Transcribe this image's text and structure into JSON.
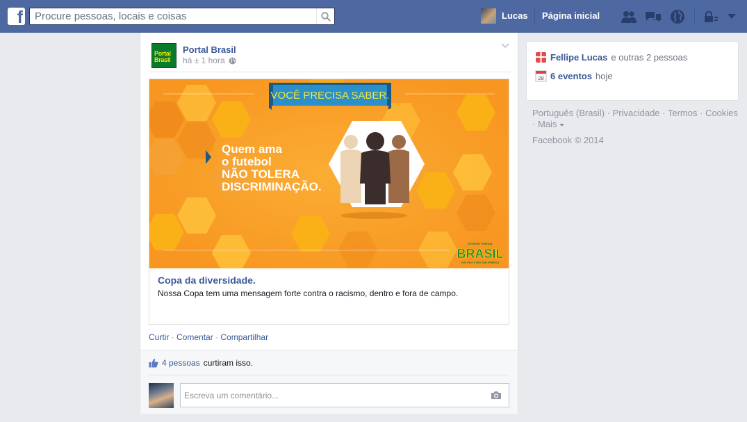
{
  "topbar": {
    "logo": "f",
    "search_placeholder": "Procure pessoas, locais e coisas",
    "user_name": "Lucas",
    "home_label": "Página inicial",
    "icons": [
      "friend-requests-icon",
      "messages-icon",
      "notifications-globe-icon",
      "privacy-lock-icon",
      "account-menu-chevron-icon"
    ]
  },
  "post": {
    "page_logo_line1": "Portal",
    "page_logo_line2": "Brasil",
    "author": "Portal Brasil",
    "time": "há ± 1 hora",
    "banner": {
      "tag": "VOCÊ PRECISA SABER.",
      "line1": "Quem ama",
      "line2": "o futebol",
      "line3": "NÃO TOLERA",
      "line4": "DISCRIMINAÇÃO.",
      "brand": "BRASIL",
      "brand_top": "GOVERNO FEDERAL",
      "brand_bottom": "PAÍS RICO É PAÍS SEM POBREZA"
    },
    "attachment_title": "Copa da diversidade.",
    "attachment_desc": "Nossa Copa tem uma mensagem forte contra o racismo, dentro e fora de campo.",
    "actions": {
      "like": "Curtir",
      "comment": "Comentar",
      "share": "Compartilhar",
      "separator": " · "
    },
    "likes": {
      "count_text": "4 pessoas",
      "suffix": "curtiram isso."
    },
    "comment_placeholder": "Escreva um comentário..."
  },
  "ticker": {
    "birthday_name": "Fellipe Lucas",
    "birthday_suffix": "e outras 2 pessoas",
    "events_count": "6 eventos",
    "events_suffix": "hoje",
    "calendar_day": "28"
  },
  "footer": {
    "links": [
      "Português (Brasil)",
      "Privacidade",
      "Termos",
      "Cookies",
      "Mais"
    ],
    "copyright": "Facebook © 2014"
  },
  "colors": {
    "brand_blue": "#4e69a2",
    "link_blue": "#3b5998",
    "banner_orange": "#f7941d",
    "hex_yellow": "#fbb316"
  }
}
